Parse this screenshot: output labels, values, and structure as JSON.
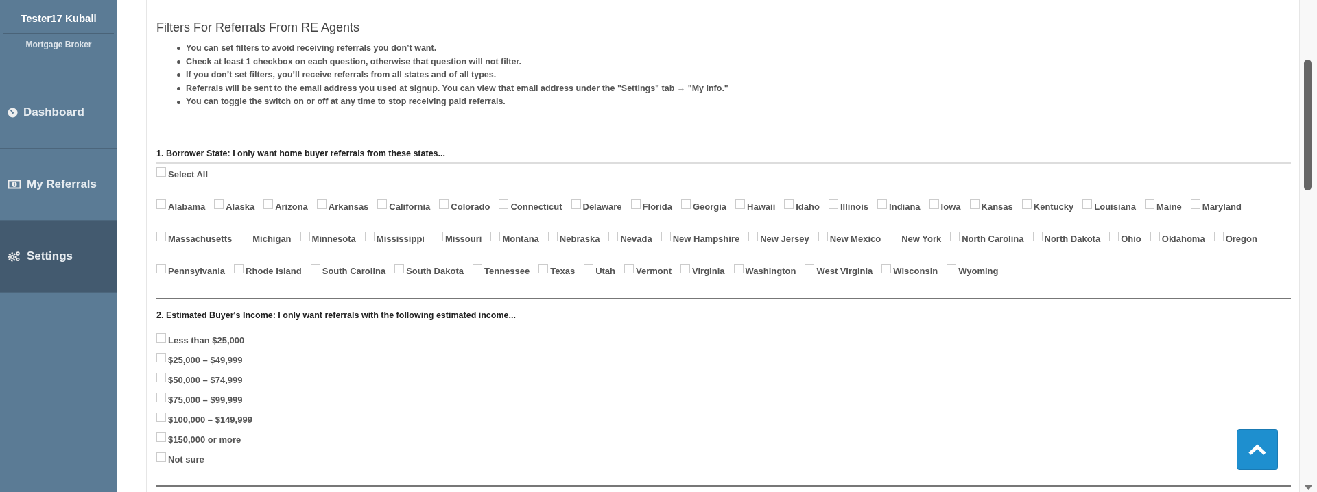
{
  "sidebar": {
    "user_name": "Tester17 Kuball",
    "role": "Mortgage Broker",
    "items": [
      {
        "label": "Dashboard",
        "selected": false
      },
      {
        "label": "My Referrals",
        "selected": false
      },
      {
        "label": "Settings",
        "selected": true
      }
    ]
  },
  "page": {
    "title": "Filters For Referrals From RE Agents",
    "notes": [
      "You can set filters to avoid receiving referrals you don’t want.",
      "Check at least 1 checkbox on each question, otherwise that question will not filter.",
      "If you don’t set filters, you’ll receive referrals from all states and of all types.",
      "Referrals will be sent to the email address you used at signup. You can view that email address under the \"Settings\" tab → \"My Info.\"",
      "You can toggle the switch on or off at any time to stop receiving paid referrals."
    ]
  },
  "questions": [
    {
      "title": "1. Borrower State: I only want home buyer referrals from these states...",
      "select_all": {
        "label": "Select All",
        "checked": false
      },
      "options": [
        {
          "label": "Alabama",
          "checked": false
        },
        {
          "label": "Alaska",
          "checked": false
        },
        {
          "label": "Arizona",
          "checked": false
        },
        {
          "label": "Arkansas",
          "checked": false
        },
        {
          "label": "California",
          "checked": false
        },
        {
          "label": "Colorado",
          "checked": false
        },
        {
          "label": "Connecticut",
          "checked": false
        },
        {
          "label": "Delaware",
          "checked": false
        },
        {
          "label": "Florida",
          "checked": false
        },
        {
          "label": "Georgia",
          "checked": false
        },
        {
          "label": "Hawaii",
          "checked": false
        },
        {
          "label": "Idaho",
          "checked": false
        },
        {
          "label": "Illinois",
          "checked": false
        },
        {
          "label": "Indiana",
          "checked": false
        },
        {
          "label": "Iowa",
          "checked": false
        },
        {
          "label": "Kansas",
          "checked": false
        },
        {
          "label": "Kentucky",
          "checked": false
        },
        {
          "label": "Louisiana",
          "checked": false
        },
        {
          "label": "Maine",
          "checked": false
        },
        {
          "label": "Maryland",
          "checked": false
        },
        {
          "label": "Massachusetts",
          "checked": false
        },
        {
          "label": "Michigan",
          "checked": false
        },
        {
          "label": "Minnesota",
          "checked": false
        },
        {
          "label": "Mississippi",
          "checked": false
        },
        {
          "label": "Missouri",
          "checked": false
        },
        {
          "label": "Montana",
          "checked": false
        },
        {
          "label": "Nebraska",
          "checked": false
        },
        {
          "label": "Nevada",
          "checked": false
        },
        {
          "label": "New Hampshire",
          "checked": false
        },
        {
          "label": "New Jersey",
          "checked": false
        },
        {
          "label": "New Mexico",
          "checked": false
        },
        {
          "label": "New York",
          "checked": false
        },
        {
          "label": "North Carolina",
          "checked": false
        },
        {
          "label": "North Dakota",
          "checked": false
        },
        {
          "label": "Ohio",
          "checked": false
        },
        {
          "label": "Oklahoma",
          "checked": false
        },
        {
          "label": "Oregon",
          "checked": false
        },
        {
          "label": "Pennsylvania",
          "checked": false
        },
        {
          "label": "Rhode Island",
          "checked": false
        },
        {
          "label": "South Carolina",
          "checked": false
        },
        {
          "label": "South Dakota",
          "checked": false
        },
        {
          "label": "Tennessee",
          "checked": false
        },
        {
          "label": "Texas",
          "checked": false
        },
        {
          "label": "Utah",
          "checked": false
        },
        {
          "label": "Vermont",
          "checked": false
        },
        {
          "label": "Virginia",
          "checked": false
        },
        {
          "label": "Washington",
          "checked": false
        },
        {
          "label": "West Virginia",
          "checked": false
        },
        {
          "label": "Wisconsin",
          "checked": false
        },
        {
          "label": "Wyoming",
          "checked": false
        }
      ]
    },
    {
      "title": "2. Estimated Buyer's Income: I only want referrals with the following estimated income...",
      "options": [
        {
          "label": "Less than $25,000",
          "checked": false
        },
        {
          "label": "$25,000 – $49,999",
          "checked": false
        },
        {
          "label": "$50,000 – $74,999",
          "checked": false
        },
        {
          "label": "$75,000 – $99,999",
          "checked": false
        },
        {
          "label": "$100,000 – $149,999",
          "checked": false
        },
        {
          "label": "$150,000 or more",
          "checked": false
        },
        {
          "label": "Not sure",
          "checked": false
        }
      ]
    }
  ]
}
